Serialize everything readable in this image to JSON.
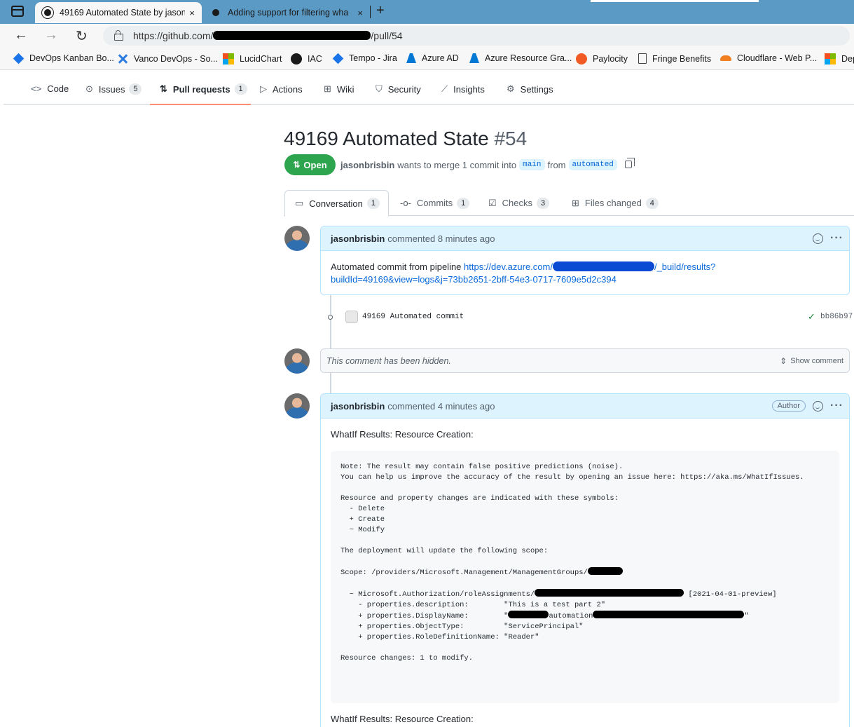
{
  "browser": {
    "tabs": [
      {
        "title": "49169 Automated State by jason",
        "close": "×"
      },
      {
        "title": "Adding support for filtering wha",
        "close": "×"
      }
    ],
    "new_tab": "+",
    "url_prefix": "https://github.com/",
    "url_suffix": "/pull/54",
    "nav": {
      "back": "←",
      "forward": "→",
      "reload": "↻"
    },
    "bookmarks": [
      {
        "label": "DevOps Kanban Bo...",
        "icon": "azure-devops-icon"
      },
      {
        "label": "Vanco DevOps - So...",
        "icon": "confluence-icon"
      },
      {
        "label": "LucidChart",
        "icon": "microsoft-icon"
      },
      {
        "label": "IAC",
        "icon": "github-icon"
      },
      {
        "label": "Tempo - Jira",
        "icon": "jira-icon"
      },
      {
        "label": "Azure AD",
        "icon": "azure-icon"
      },
      {
        "label": "Azure Resource Gra...",
        "icon": "azure-icon"
      },
      {
        "label": "Paylocity",
        "icon": "paylocity-icon"
      },
      {
        "label": "Fringe Benefits",
        "icon": "document-icon"
      },
      {
        "label": "Cloudflare - Web P...",
        "icon": "cloudflare-icon"
      },
      {
        "label": "Dep",
        "icon": "microsoft-icon"
      }
    ]
  },
  "repo_nav": {
    "items": [
      {
        "label": "Code",
        "icon": "<>"
      },
      {
        "label": "Issues",
        "icon": "⊙",
        "count": "5"
      },
      {
        "label": "Pull requests",
        "icon": "⇅",
        "count": "1"
      },
      {
        "label": "Actions",
        "icon": "▷"
      },
      {
        "label": "Wiki",
        "icon": "⊞"
      },
      {
        "label": "Security",
        "icon": "⛉"
      },
      {
        "label": "Insights",
        "icon": "⟋"
      },
      {
        "label": "Settings",
        "icon": "⚙"
      }
    ]
  },
  "pr": {
    "title": "49169 Automated State",
    "number": "#54",
    "state": "Open",
    "author": "jasonbrisbin",
    "merge_text": "wants to merge 1 commit into",
    "base_branch": "main",
    "from_text": "from",
    "head_branch": "automated"
  },
  "pr_tabs": [
    {
      "label": "Conversation",
      "count": "1"
    },
    {
      "label": "Commits",
      "count": "1"
    },
    {
      "label": "Checks",
      "count": "3"
    },
    {
      "label": "Files changed",
      "count": "4"
    }
  ],
  "timeline": {
    "comment1": {
      "author": "jasonbrisbin",
      "meta": "commented 8 minutes ago",
      "text": "Automated commit from pipeline ",
      "link_start": "https://dev.azure.com/",
      "link_mid": "/_build/results?",
      "link_end": "buildId=49169&view=logs&j=73bb2651-2bff-54e3-0717-7609e5d2c394"
    },
    "commit": {
      "message": "49169 Automated commit",
      "sha": "bb86b97"
    },
    "hidden": {
      "text": "This comment has been hidden.",
      "action": "Show comment"
    },
    "comment2": {
      "author": "jasonbrisbin",
      "meta": "commented 4 minutes ago",
      "badge": "Author",
      "heading": "WhatIf Results: Resource Creation:",
      "code": {
        "l1": "Note: The result may contain false positive predictions (noise).",
        "l2": "You can help us improve the accuracy of the result by opening an issue here: https://aka.ms/WhatIfIssues.",
        "l3": "Resource and property changes are indicated with these symbols:",
        "l4": "  - Delete",
        "l5": "  + Create",
        "l6": "  ~ Modify",
        "l7": "The deployment will update the following scope:",
        "l8": "Scope: /providers/Microsoft.Management/ManagementGroups/",
        "l9a": "  ~ Microsoft.Authorization/roleAssignments/",
        "l9b": " [2021-04-01-preview]",
        "l10": "    - properties.description:        \"This is a test part 2\"",
        "l11a": "    + properties.DisplayName:        \"",
        "l11b": "automation",
        "l11c": "\"",
        "l12": "    + properties.ObjectType:         \"ServicePrincipal\"",
        "l13": "    + properties.RoleDefinitionName: \"Reader\"",
        "l14": "Resource changes: 1 to modify."
      },
      "after": "WhatIf Results: Resource Creation:"
    }
  }
}
